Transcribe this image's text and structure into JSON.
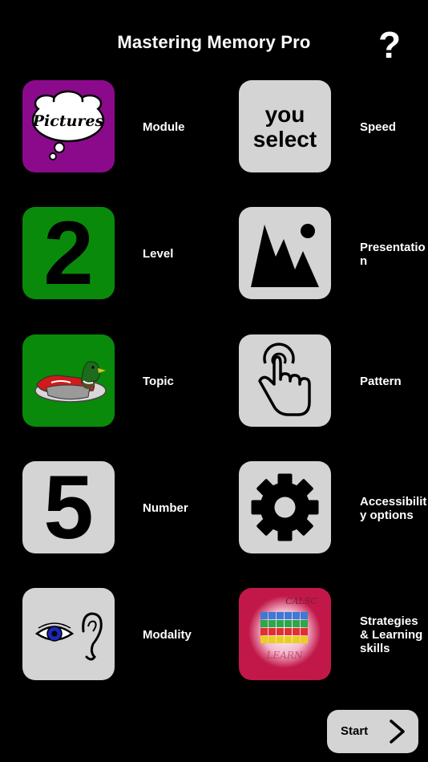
{
  "header": {
    "title": "Mastering Memory Pro",
    "help_icon": "question-mark-icon"
  },
  "tiles": {
    "module": {
      "label": "Module",
      "tile_text": "Pictures",
      "icon": "pictures-thought-bubble-icon",
      "color": "#8b0a8b"
    },
    "speed": {
      "label": "Speed",
      "tile_line1": "you",
      "tile_line2": "select",
      "color": "#d4d4d4"
    },
    "level": {
      "label": "Level",
      "value": "2",
      "color": "#0a8a0a"
    },
    "presentation": {
      "label": "Presentation",
      "icon": "picture-mountains-icon",
      "color": "#d4d4d4"
    },
    "topic": {
      "label": "Topic",
      "icon": "duck-icon",
      "color": "#0a8a0a"
    },
    "pattern": {
      "label": "Pattern",
      "icon": "tap-hand-icon",
      "color": "#d4d4d4"
    },
    "number": {
      "label": "Number",
      "value": "5",
      "color": "#d4d4d4"
    },
    "accessibility": {
      "label_line1": "Accessibilit",
      "label_line2": "y options",
      "icon": "gear-icon",
      "color": "#d4d4d4"
    },
    "modality": {
      "label": "Modality",
      "icon": "eye-and-ear-icon",
      "color": "#d4d4d4"
    },
    "strategies": {
      "label_line1": "Strategies",
      "label_line2": "& Learning",
      "label_line3": "skills",
      "icon": "calsc-grid-icon",
      "color": "#c21849"
    }
  },
  "footer": {
    "start_label": "Start",
    "start_icon": "chevron-right-icon"
  }
}
